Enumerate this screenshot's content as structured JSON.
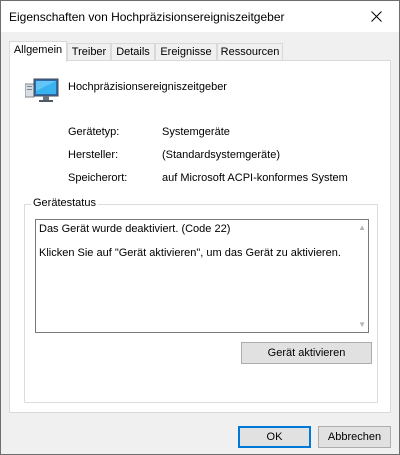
{
  "window": {
    "title": "Eigenschaften von Hochpräzisionsereigniszeitgeber"
  },
  "tabs": [
    {
      "label": "Allgemein",
      "active": true
    },
    {
      "label": "Treiber",
      "active": false
    },
    {
      "label": "Details",
      "active": false
    },
    {
      "label": "Ereignisse",
      "active": false
    },
    {
      "label": "Ressourcen",
      "active": false
    }
  ],
  "device": {
    "name": "Hochpräzisionsereigniszeitgeber",
    "icon": "computer-device-icon"
  },
  "properties": [
    {
      "label": "Gerätetyp:",
      "value": "Systemgeräte"
    },
    {
      "label": "Hersteller:",
      "value": "(Standardsystemgeräte)"
    },
    {
      "label": "Speicherort:",
      "value": "auf Microsoft ACPI-konformes System"
    }
  ],
  "status": {
    "group_title": "Gerätestatus",
    "line1": "Das Gerät wurde deaktiviert. (Code 22)",
    "line2": "Klicken Sie auf \"Gerät aktivieren\", um das Gerät zu aktivieren.",
    "activate_button": "Gerät aktivieren"
  },
  "footer": {
    "ok_label": "OK",
    "cancel_label": "Abbrechen"
  },
  "colors": {
    "accent": "#0078d7",
    "panel_bg": "#ffffff",
    "window_bg": "#f0f0f0"
  }
}
